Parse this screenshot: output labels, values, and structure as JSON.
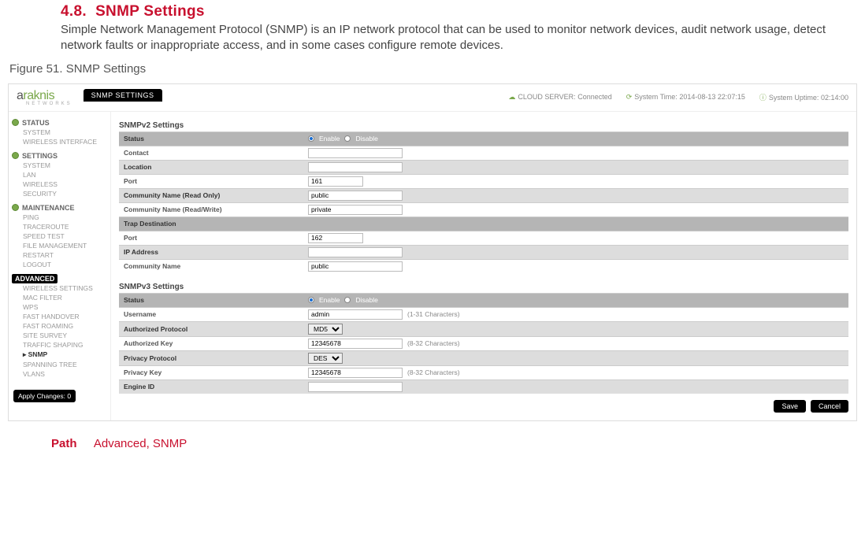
{
  "section": {
    "number": "4.8.",
    "title": "SNMP Settings",
    "body": "Simple Network Management Protocol (SNMP) is an IP network protocol that can be used to monitor network devices, audit network usage, detect network faults or inappropriate access, and in some cases configure remote devices."
  },
  "figure_caption": "Figure 51. SNMP Settings",
  "top": {
    "logo": "araknis",
    "logo_sub": "NETWORKS",
    "cloud": "CLOUD SERVER:",
    "cloud_state": "Connected",
    "systime_label": "System Time:",
    "systime_value": "2014-08-13 22:07:15",
    "uptime_label": "System Uptime:",
    "uptime_value": "02:14:00"
  },
  "nav": {
    "status": {
      "head": "STATUS",
      "items": [
        "SYSTEM",
        "WIRELESS INTERFACE"
      ]
    },
    "settings": {
      "head": "SETTINGS",
      "items": [
        "SYSTEM",
        "LAN",
        "WIRELESS",
        "SECURITY"
      ]
    },
    "maintenance": {
      "head": "MAINTENANCE",
      "items": [
        "PING",
        "TRACEROUTE",
        "SPEED TEST",
        "FILE MANAGEMENT",
        "RESTART",
        "LOGOUT"
      ]
    },
    "advanced": {
      "head": "ADVANCED",
      "items": [
        "WIRELESS SETTINGS",
        "MAC FILTER",
        "WPS",
        "FAST HANDOVER",
        "FAST ROAMING",
        "SITE SURVEY",
        "TRAFFIC SHAPING",
        "SNMP",
        "SPANNING TREE",
        "VLANS"
      ]
    },
    "apply": "Apply Changes: 0"
  },
  "panel_tab": "SNMP SETTINGS",
  "v2": {
    "title": "SNMPv2 Settings",
    "status_label": "Status",
    "enable": "Enable",
    "disable": "Disable",
    "contact_label": "Contact",
    "location_label": "Location",
    "port_label": "Port",
    "port_value": "161",
    "ro_label": "Community Name (Read Only)",
    "ro_value": "public",
    "rw_label": "Community Name (Read/Write)",
    "rw_value": "private",
    "trap_label": "Trap Destination",
    "trap_port_label": "Port",
    "trap_port_value": "162",
    "ip_label": "IP Address",
    "comm_label": "Community Name",
    "comm_value": "public"
  },
  "v3": {
    "title": "SNMPv3 Settings",
    "status_label": "Status",
    "enable": "Enable",
    "disable": "Disable",
    "user_label": "Username",
    "user_value": "admin",
    "user_hint": "(1-31 Characters)",
    "authp_label": "Authorized Protocol",
    "authp_value": "MD5",
    "authk_label": "Authorized Key",
    "authk_value": "12345678",
    "authk_hint": "(8-32 Characters)",
    "privp_label": "Privacy Protocol",
    "privp_value": "DES",
    "privk_label": "Privacy Key",
    "privk_value": "12345678",
    "privk_hint": "(8-32 Characters)",
    "engine_label": "Engine ID"
  },
  "buttons": {
    "save": "Save",
    "cancel": "Cancel"
  },
  "path": {
    "label": "Path",
    "value": "Advanced, SNMP"
  }
}
